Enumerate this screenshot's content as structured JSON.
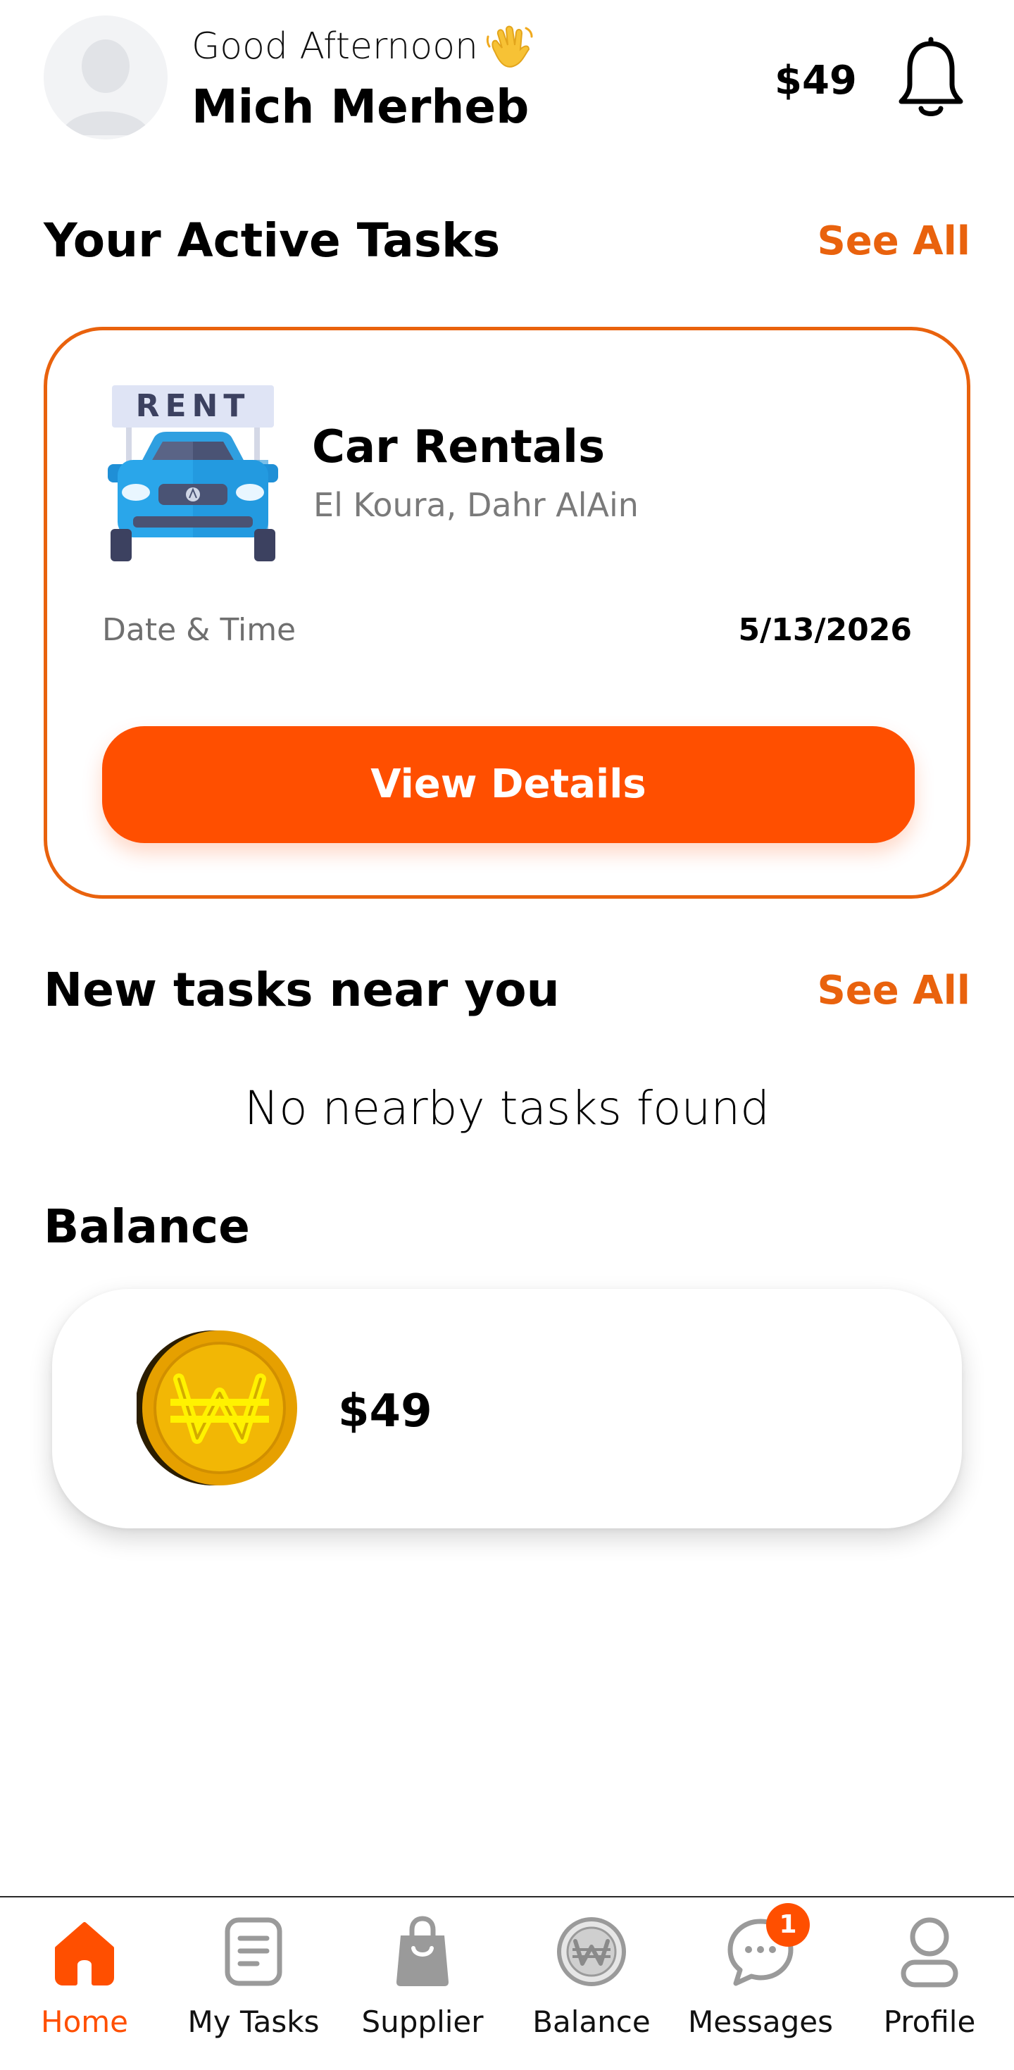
{
  "header": {
    "greeting": "Good Afternoon",
    "user_name": "Mich Merheb",
    "balance": "$49"
  },
  "active_tasks": {
    "title": "Your Active Tasks",
    "see_all": "See All",
    "task": {
      "image_label": "RENT",
      "title": "Car Rentals",
      "location": "El Koura, Dahr AlAin",
      "datetime_label": "Date & Time",
      "datetime_value": "5/13/2026",
      "button_label": "View Details"
    }
  },
  "nearby_tasks": {
    "title": "New tasks near you",
    "see_all": "See All",
    "empty_text": "No nearby tasks found"
  },
  "balance": {
    "title": "Balance",
    "amount": "$49"
  },
  "nav": {
    "items": [
      {
        "label": "Home",
        "icon": "home-icon"
      },
      {
        "label": "My Tasks",
        "icon": "tasks-icon"
      },
      {
        "label": "Supplier",
        "icon": "shopping-bag-icon"
      },
      {
        "label": "Balance",
        "icon": "coin-icon"
      },
      {
        "label": "Messages",
        "icon": "chat-icon",
        "badge": "1"
      },
      {
        "label": "Profile",
        "icon": "user-icon"
      }
    ],
    "active": "Home"
  },
  "colors": {
    "accent": "#ff4f00",
    "link": "#e9620d",
    "card_border": "#e9620d"
  }
}
